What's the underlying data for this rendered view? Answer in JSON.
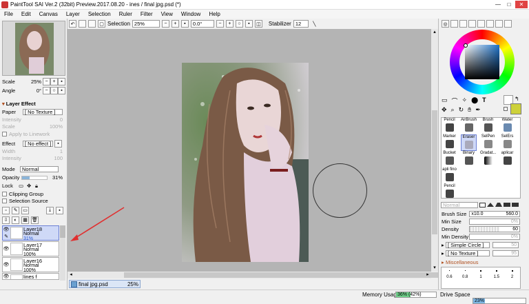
{
  "window": {
    "title": "PaintTool SAI Ver.2 (32bit) Preview.2017.08.20 - ines / final jpg.psd (*)",
    "min": "—",
    "max": "□",
    "close": "✕"
  },
  "menu": [
    "File",
    "Edit",
    "Canvas",
    "Layer",
    "Selection",
    "Ruler",
    "Filter",
    "View",
    "Window",
    "Help"
  ],
  "toolbar": {
    "selection_label": "Selection",
    "zoom": "25%",
    "rotation": "0.0°",
    "stabilizer_label": "Stabilizer",
    "stabilizer": "12"
  },
  "navigator": {
    "scale_label": "Scale",
    "scale_value": "25%",
    "angle_label": "Angle",
    "angle_value": "0°"
  },
  "layer_effect": {
    "header": "Layer Effect",
    "paper_label": "Paper",
    "paper_value": "[ No Texture ]",
    "intensity_label": "Intensity",
    "intensity_value": "0",
    "scale_label": "Scale",
    "scale_value": "100%",
    "apply_linework": "Apply to Linework",
    "effect_label": "Effect",
    "effect_value": "[ No effect ]",
    "width_label": "Width",
    "width_value": "1",
    "intensity2_label": "Intensity",
    "intensity2_value": "100"
  },
  "layer_props": {
    "mode_label": "Mode",
    "mode_value": "Normal",
    "opacity_label": "Opacity",
    "opacity_value": "31%",
    "opacity_fraction": 0.31,
    "lock_label": "Lock",
    "clipping_group": "Clipping Group",
    "selection_source": "Selection Source"
  },
  "layers": [
    {
      "name": "Layer18",
      "mode": "Normal",
      "opacity": "31%"
    },
    {
      "name": "Layer17",
      "mode": "Normal",
      "opacity": "100%"
    },
    {
      "name": "Layer16",
      "mode": "Normal",
      "opacity": "100%"
    },
    {
      "name": "lines f",
      "mode": "",
      "opacity": ""
    }
  ],
  "tab": {
    "name": "final jpg.psd",
    "zoom": "25%"
  },
  "tools": [
    "Pencil",
    "AirBrush",
    "Brush",
    "Water",
    "Marker",
    "Eraser",
    "SelPen",
    "SelErs",
    "Bucket",
    "Binary",
    "Gradat...",
    "aplicar",
    "apli fino",
    "",
    "",
    "",
    "Pencil",
    "",
    "",
    ""
  ],
  "brush": {
    "mode_value": "Normal",
    "size_label": "Brush Size",
    "size_mult": "x10.0",
    "size_value": "560.0",
    "min_size_label": "Min Size",
    "min_size_value": "0%",
    "density_label": "Density",
    "density_value": "60",
    "min_density_label": "Min Density",
    "min_density_value": "0%",
    "shape_value": "[ Simple Circle ]",
    "shape_num": "50",
    "texture_value": "[ No Texture ]",
    "texture_num": "95",
    "misc_label": "Miscellaneous",
    "presets": [
      "0.6",
      "0.8",
      "1",
      "1.5",
      "2"
    ]
  },
  "status": {
    "memory_label": "Memory Usage",
    "memory_value": "36% (42%)",
    "memory_fraction": 0.36,
    "drive_label": "Drive Space",
    "drive_value": "23%",
    "drive_fraction": 0.23
  },
  "colors": {
    "primary": "#cdd13a",
    "secondary": "#ffffff",
    "accent": "#e03030"
  }
}
